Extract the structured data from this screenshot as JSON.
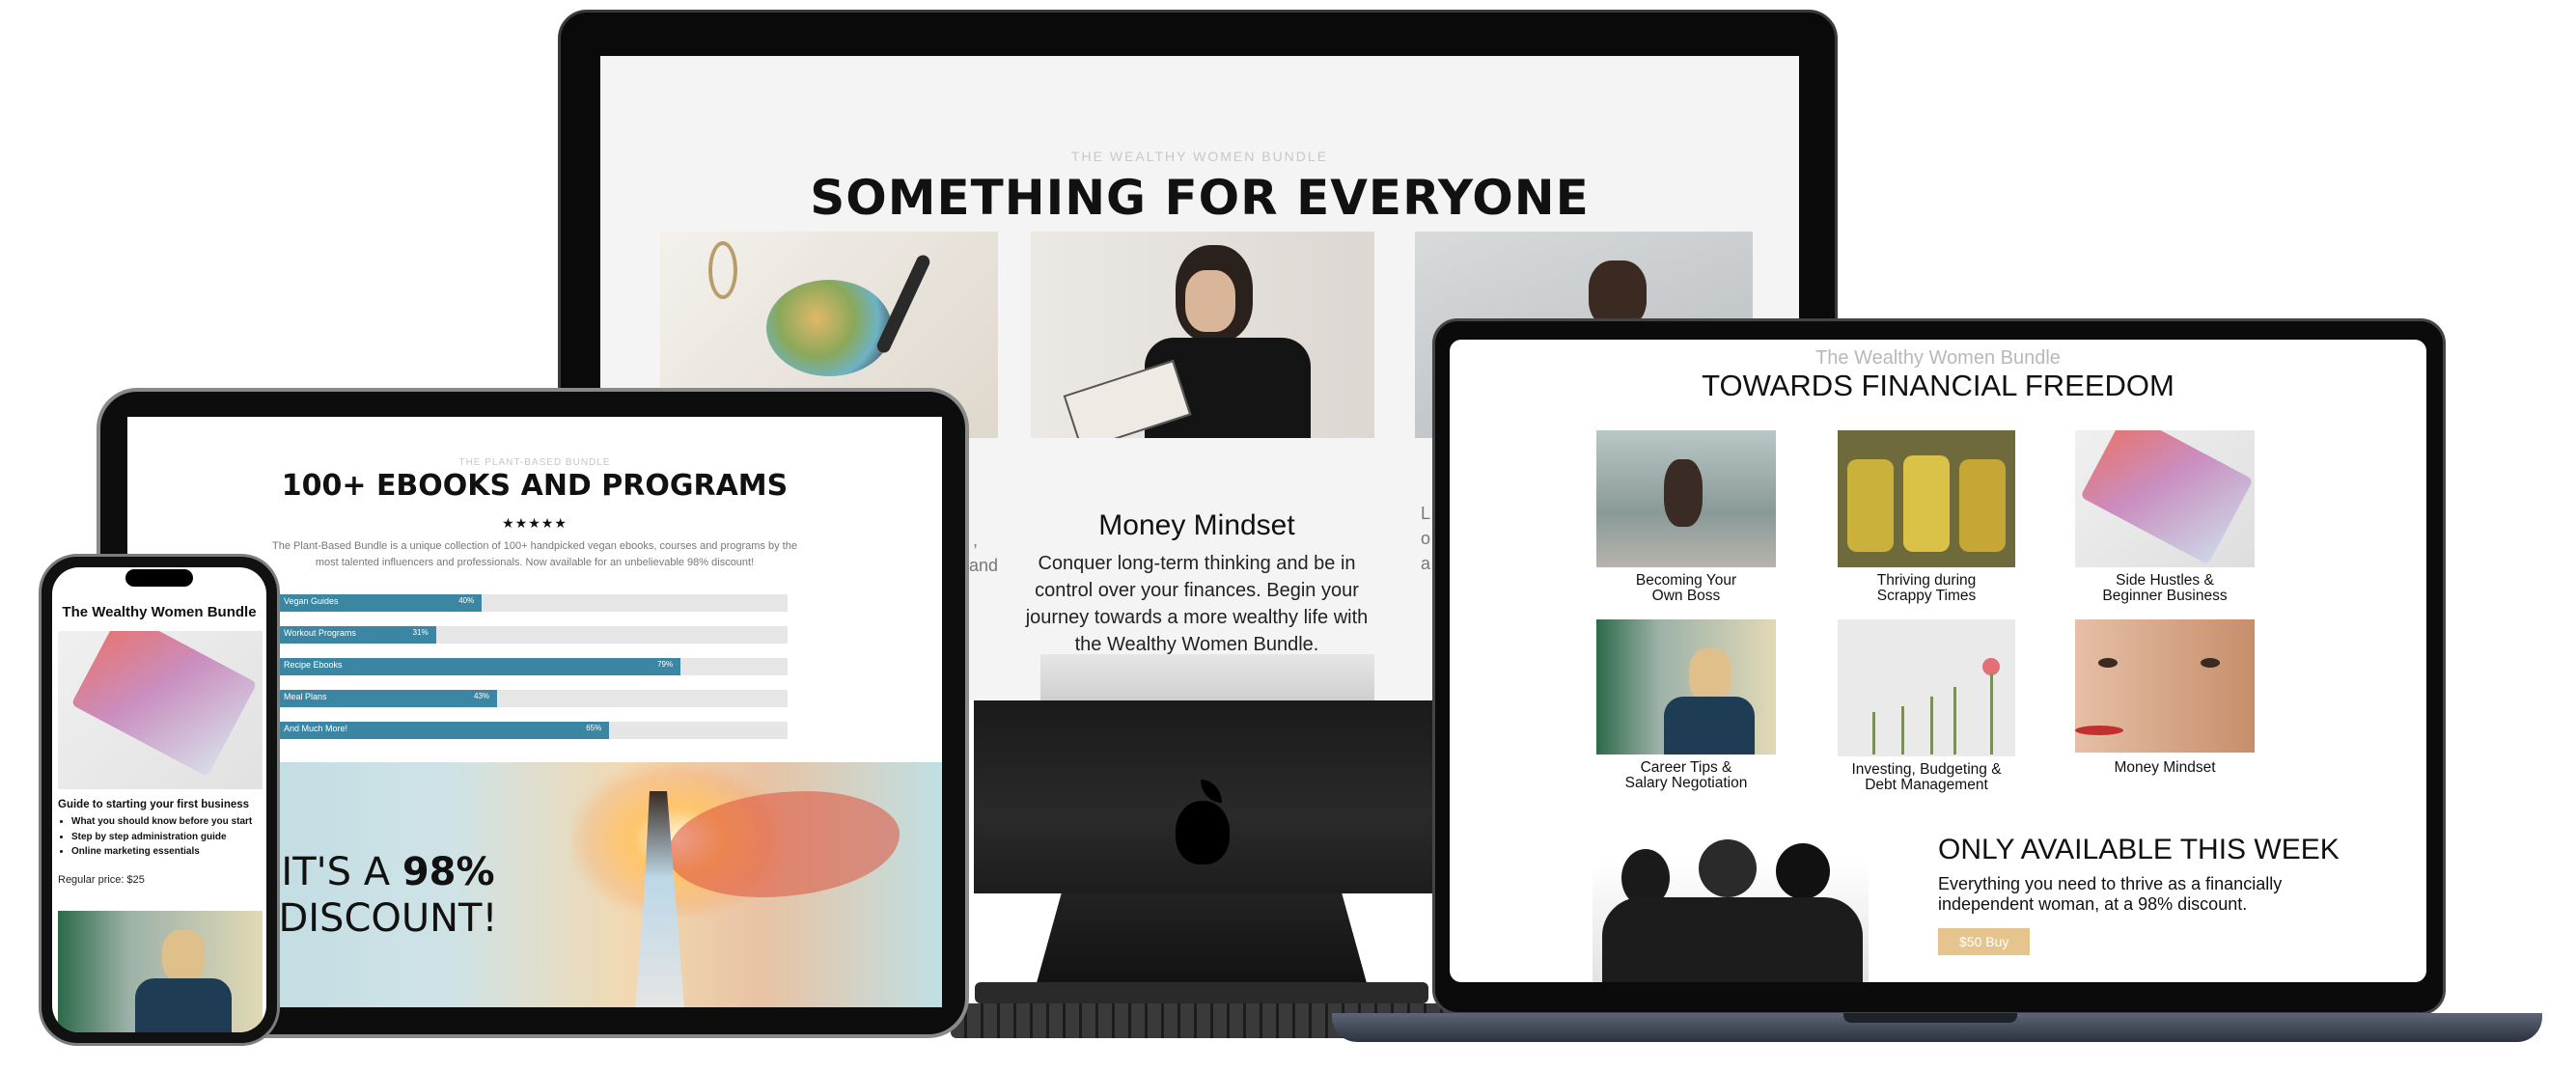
{
  "imac": {
    "kicker": "THE WEALTHY WOMEN BUNDLE",
    "title": "SOMETHING FOR EVERYONE",
    "card": {
      "title": "Money Mindset",
      "text": "Conquer long-term thinking and be in control over your finances. Begin your journey towards a more wealthy life with the Wealthy Women Bundle."
    },
    "left_fragments": [
      ",",
      "and"
    ],
    "right_fragments": [
      "L",
      "o",
      "a"
    ]
  },
  "tablet": {
    "kicker": "THE PLANT-BASED BUNDLE",
    "title": "100+ EBOOKS AND PROGRAMS",
    "stars": "★★★★★",
    "description": "The Plant-Based Bundle is a unique collection of 100+ handpicked vegan ebooks, courses and programs by the most talented influencers and professionals. Now available for an unbelievable 98% discount!",
    "bars": [
      {
        "label": "Vegan Guides",
        "value": 40,
        "text": "40%"
      },
      {
        "label": "Workout Programs",
        "value": 31,
        "text": "31%"
      },
      {
        "label": "Recipe Ebooks",
        "value": 79,
        "text": "79%"
      },
      {
        "label": "Meal Plans",
        "value": 43,
        "text": "43%"
      },
      {
        "label": "And Much More!",
        "value": 65,
        "text": "65%"
      }
    ],
    "hero_line1_a": "IT'S A ",
    "hero_line1_b": "98%",
    "hero_line2": "DISCOUNT!"
  },
  "phone": {
    "title": "The Wealthy Women Bundle",
    "heading": "Guide to starting your first business",
    "bullets": [
      "What you should know before you start",
      "Step by step administration guide",
      "Online marketing essentials"
    ],
    "price": "Regular price: $25"
  },
  "laptop": {
    "kicker": "The Wealthy Women Bundle",
    "title": "TOWARDS FINANCIAL FREEDOM",
    "items": [
      {
        "line1": "Becoming Your",
        "line2": "Own Boss"
      },
      {
        "line1": "Thriving during",
        "line2": "Scrappy Times"
      },
      {
        "line1": "Side Hustles &",
        "line2": "Beginner Business"
      },
      {
        "line1": "Career Tips &",
        "line2": "Salary Negotiation"
      },
      {
        "line1": "Investing, Budgeting &",
        "line2": "Debt Management"
      },
      {
        "line1": "Money Mindset",
        "line2": ""
      }
    ],
    "offer": {
      "title": "ONLY AVAILABLE THIS WEEK",
      "text": "Everything you need to thrive as a financially independent woman, at a 98% discount.",
      "button": "$50 Buy"
    }
  },
  "colors": {
    "bar": "#3b87a3",
    "buy": "#e6c48d"
  }
}
